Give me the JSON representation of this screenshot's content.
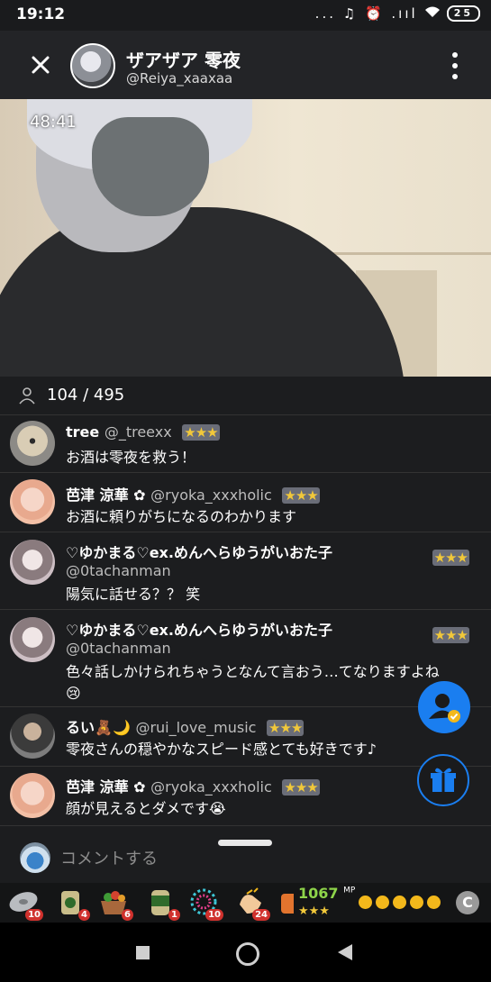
{
  "status_bar": {
    "time": "19:12",
    "icons": "... ♫ ⏰ .ııl",
    "battery": "25"
  },
  "header": {
    "display_name": "ザアザア 零夜",
    "handle": "@Reiya_xaaxaa"
  },
  "video": {
    "elapsed": "48:41"
  },
  "viewers": {
    "count_text": "104 / 495"
  },
  "comments": [
    {
      "name": "tree",
      "id": "@_treexx",
      "stars": "★★★",
      "text": "お酒は零夜を救う！"
    },
    {
      "name": "芭津 涼華",
      "id": "@ryoka_xxxholic",
      "stars": "★★★",
      "text": "お酒に頼りがちになるのわかります"
    },
    {
      "name": "♡ゆかまる♡ex.めんへらゆうがいおた子",
      "id": "@0tachanman",
      "stars": "★★★",
      "text": "陽気に話せる？？ 笑"
    },
    {
      "name": "♡ゆかまる♡ex.めんへらゆうがいおた子",
      "id": "@0tachanman",
      "stars": "★★★",
      "text": "色々話しかけられちゃうとなんて言おう…てなりますよね"
    },
    {
      "name": "るい",
      "id": "@rui_love_music",
      "stars": "★★★",
      "text": "零夜さんの穏やかなスピード感とても好きです♪"
    },
    {
      "name": "芭津 涼華",
      "id": "@ryoka_xxxholic",
      "stars": "★★★",
      "text": "顔が見えるとダメです"
    }
  ],
  "input": {
    "placeholder": "コメントする"
  },
  "items": [
    {
      "icon": "disc-item-icon",
      "count": "10"
    },
    {
      "icon": "tea-cup-item-icon",
      "count": "4"
    },
    {
      "icon": "vegetable-basket-item-icon",
      "count": "6"
    },
    {
      "icon": "tea-can-item-icon",
      "count": "1"
    },
    {
      "icon": "fireworks-item-icon",
      "count": "10"
    },
    {
      "icon": "clap-item-icon",
      "count": "24"
    }
  ],
  "mp": {
    "value": "1067",
    "unit": "MP",
    "stars": "★★★"
  },
  "coin_label": "C",
  "colors": {
    "accent": "#1a7ef0",
    "star": "#f1c83a",
    "badge": "#d0312d",
    "mp": "#8ed44a"
  }
}
